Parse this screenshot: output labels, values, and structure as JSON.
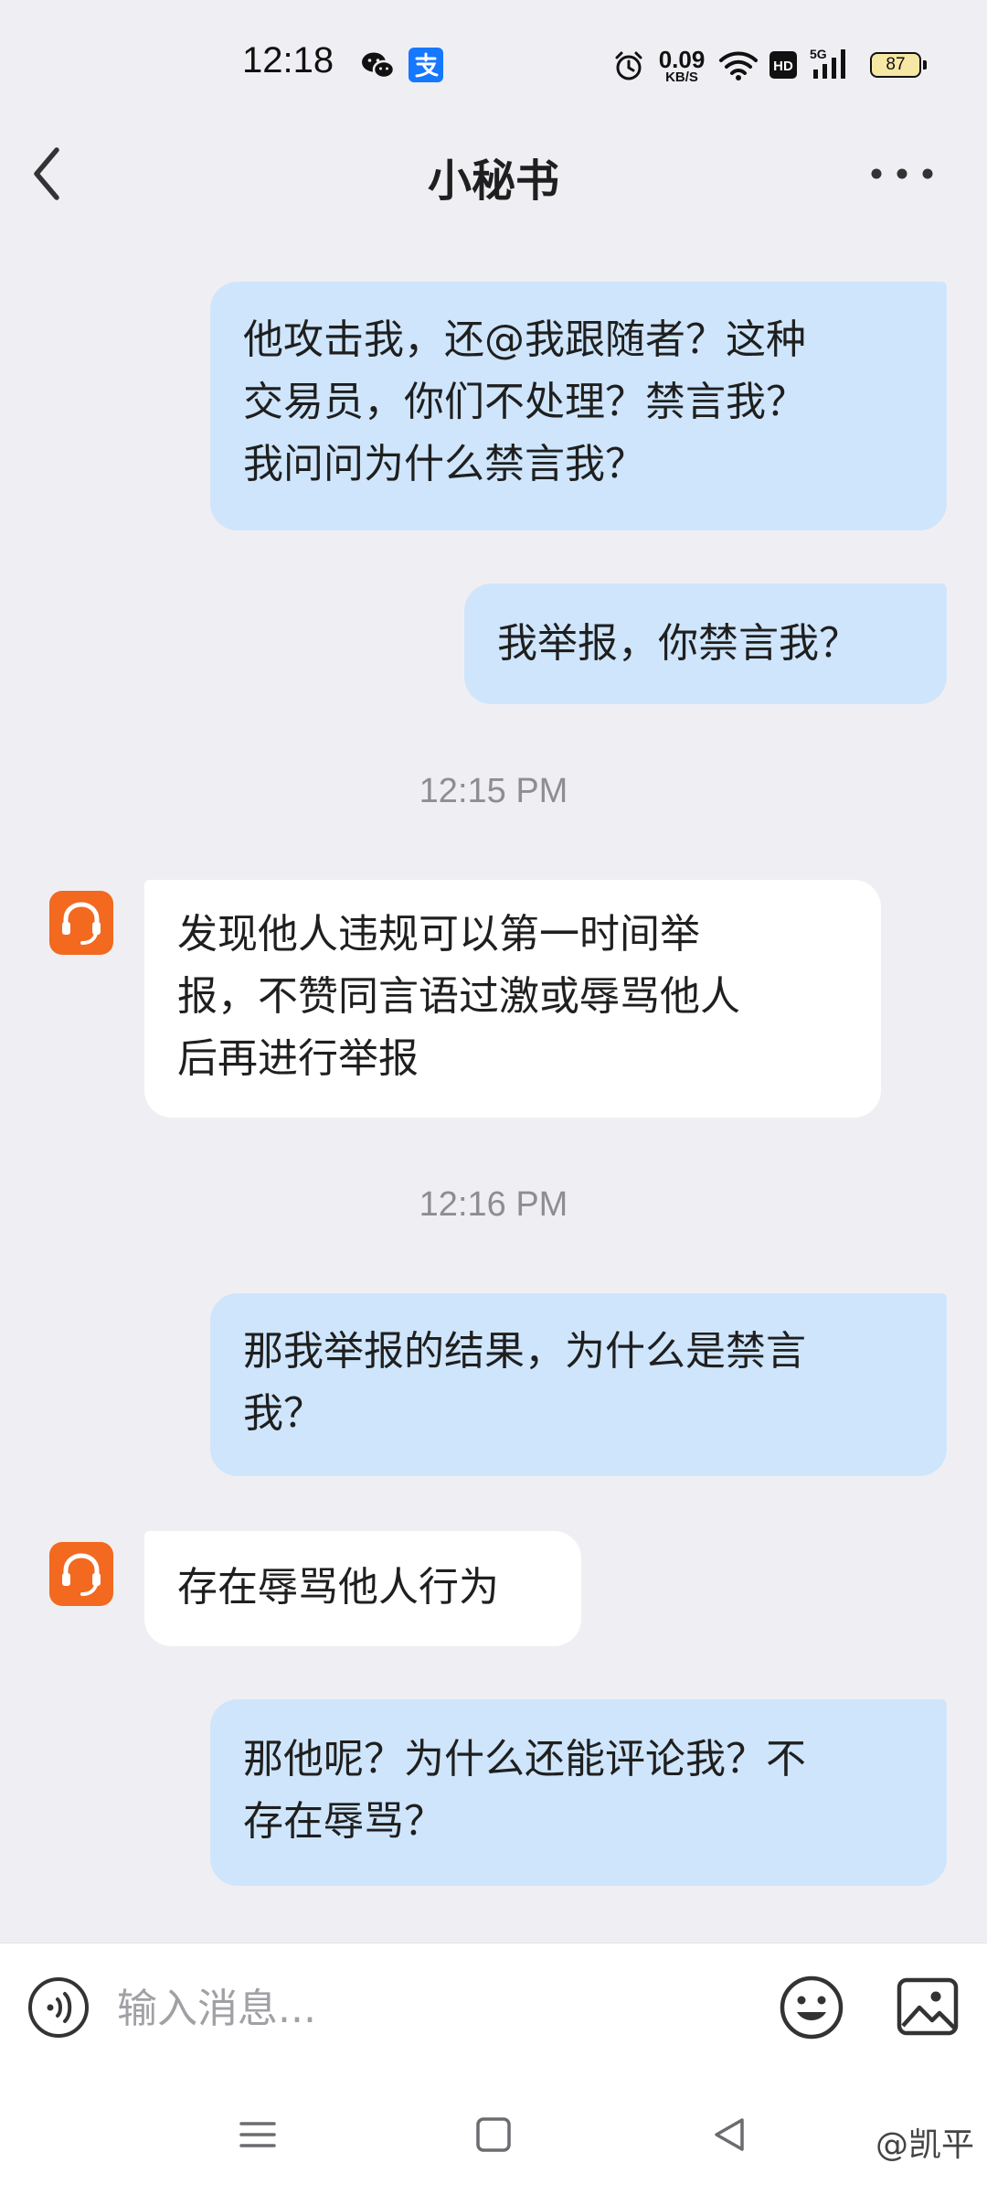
{
  "status_bar": {
    "time": "12:18",
    "net_speed_value": "0.09",
    "net_speed_unit": "KB/S",
    "battery": "87",
    "icons": [
      "wechat-icon",
      "alipay-icon",
      "alarm-icon",
      "wifi-icon",
      "hd-icon",
      "signal-5g-icon",
      "battery-icon"
    ]
  },
  "header": {
    "title": "小秘书",
    "back_icon": "chevron-left-icon",
    "more_icon": "more-dots-icon"
  },
  "conversation": {
    "accent_outgoing": "#cfe5fb",
    "accent_incoming": "#ffffff",
    "avatar_color": "#f2691f",
    "messages": [
      {
        "side": "out",
        "lines": [
          "他攻击我，还@我跟随者？这种",
          "交易员，你们不处理？禁言我？",
          "我问问为什么禁言我？"
        ]
      },
      {
        "side": "out",
        "lines": [
          "我举报，你禁言我？"
        ]
      },
      {
        "side": "timestamp",
        "text": "12:15 PM"
      },
      {
        "side": "in",
        "lines": [
          "发现他人违规可以第一时间举",
          "报，不赞同言语过激或辱骂他人",
          "后再进行举报"
        ]
      },
      {
        "side": "timestamp",
        "text": "12:16 PM"
      },
      {
        "side": "out",
        "lines": [
          "那我举报的结果，为什么是禁言",
          "我？"
        ]
      },
      {
        "side": "in",
        "lines": [
          "存在辱骂他人行为"
        ]
      },
      {
        "side": "out",
        "lines": [
          "那他呢？为什么还能评论我？不",
          "存在辱骂？"
        ]
      }
    ]
  },
  "input_bar": {
    "placeholder": "输入消息...",
    "value": "",
    "icons": [
      "voice-icon",
      "emoji-icon",
      "image-icon"
    ]
  },
  "nav_bar": {
    "icons": [
      "menu-icon",
      "home-square-icon",
      "back-triangle-icon"
    ],
    "watermark": "@凯平"
  }
}
